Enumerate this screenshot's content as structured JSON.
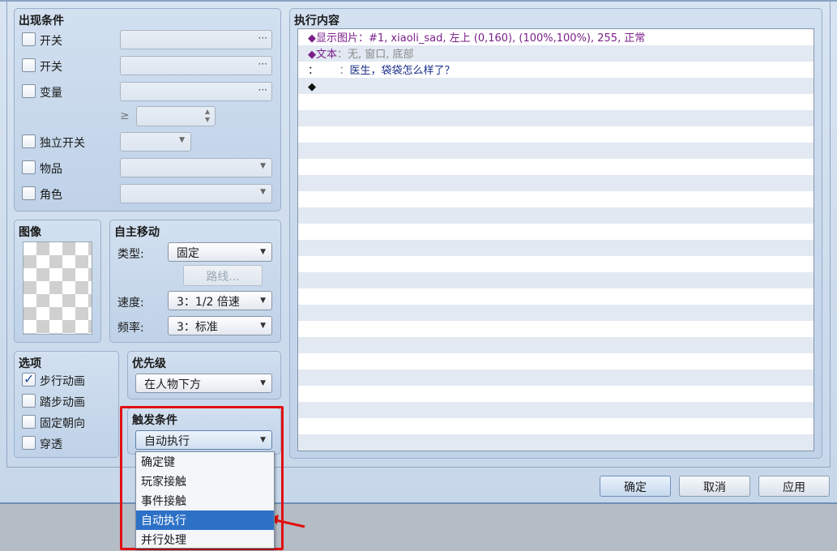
{
  "conditions": {
    "title": "出现条件",
    "switch1_label": "开关",
    "switch2_label": "开关",
    "variable_label": "变量",
    "compare_symbol": "≥",
    "self_switch_label": "独立开关",
    "item_label": "物品",
    "actor_label": "角色"
  },
  "image": {
    "title": "图像"
  },
  "autonomous": {
    "title": "自主移动",
    "type_label": "类型:",
    "type_value": "固定",
    "route_button": "路线...",
    "speed_label": "速度:",
    "speed_value": "3：1/2 倍速",
    "freq_label": "频率:",
    "freq_value": "3：标准"
  },
  "options": {
    "title": "选项",
    "items": [
      {
        "label": "步行动画",
        "checked": true
      },
      {
        "label": "踏步动画",
        "checked": false
      },
      {
        "label": "固定朝向",
        "checked": false
      },
      {
        "label": "穿透",
        "checked": false
      }
    ]
  },
  "priority": {
    "title": "优先级",
    "value": "在人物下方"
  },
  "trigger": {
    "title": "触发条件",
    "value": "自动执行",
    "options": [
      "确定键",
      "玩家接触",
      "事件接触",
      "自动执行",
      "并行处理"
    ],
    "selected_index": 3
  },
  "contents": {
    "title": "执行内容",
    "line1_cmd": "◆显示图片：",
    "line1_args": "#1, xiaoli_sad, 左上 (0,160), (100%,100%), 255, 正常",
    "line2_cmd": "◆文本",
    "line2_args": "：无, 窗口, 底部",
    "line3_prefix": "：",
    "line3_colon": "：",
    "line3_text": "医生，袋袋怎么样了？",
    "line4": "◆"
  },
  "buttons": {
    "ok": "确定",
    "cancel": "取消",
    "apply": "应用"
  },
  "colors": {
    "highlight": "#e01010",
    "selected_item": "#2d71c7",
    "command_text": "#7a1f8a",
    "message_text": "#1a2e8a"
  }
}
